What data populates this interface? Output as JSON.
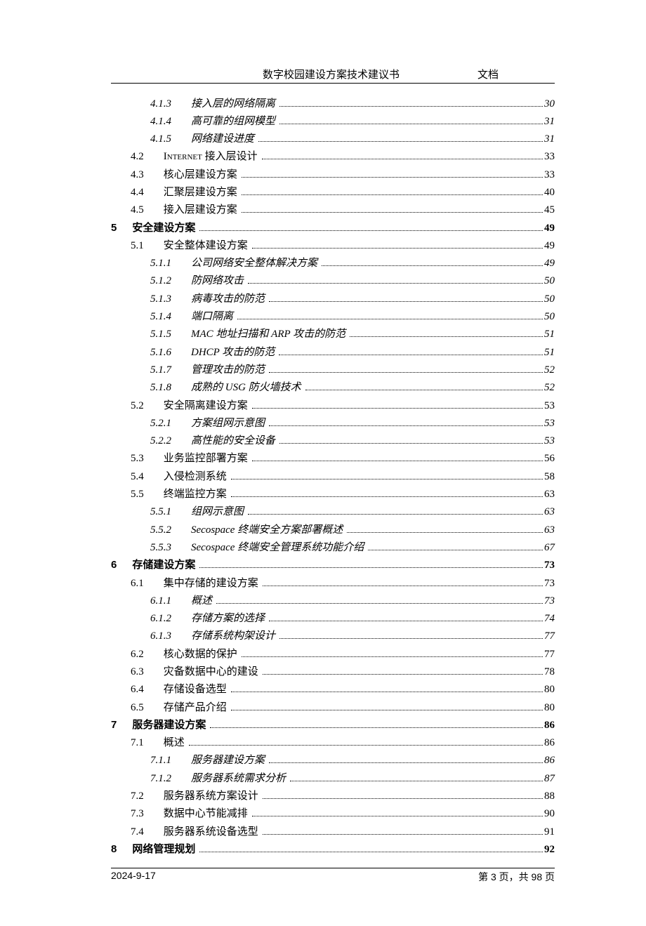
{
  "header": {
    "title": "数字校园建设方案技术建议书",
    "right": "文档"
  },
  "toc": [
    {
      "level": 3,
      "num": "4.1.3",
      "title": "接入层的网络隔离",
      "page": "30"
    },
    {
      "level": 3,
      "num": "4.1.4",
      "title": "高可靠的组网模型",
      "page": "31"
    },
    {
      "level": 3,
      "num": "4.1.5",
      "title": "网络建设进度",
      "page": "31"
    },
    {
      "level": 2,
      "num": "4.2",
      "title": "Internet 接入层设计",
      "smallcaps": true,
      "page": "33"
    },
    {
      "level": 2,
      "num": "4.3",
      "title": "核心层建设方案",
      "page": "33"
    },
    {
      "level": 2,
      "num": "4.4",
      "title": "汇聚层建设方案",
      "page": "40"
    },
    {
      "level": 2,
      "num": "4.5",
      "title": "接入层建设方案",
      "page": "45"
    },
    {
      "level": 1,
      "num": "5",
      "title": "安全建设方案",
      "page": "49"
    },
    {
      "level": 2,
      "num": "5.1",
      "title": "安全整体建设方案",
      "page": "49"
    },
    {
      "level": 3,
      "num": "5.1.1",
      "title": "公司网络安全整体解决方案",
      "page": "49"
    },
    {
      "level": 3,
      "num": "5.1.2",
      "title": "防网络攻击",
      "page": "50"
    },
    {
      "level": 3,
      "num": "5.1.3",
      "title": "病毒攻击的防范",
      "page": "50"
    },
    {
      "level": 3,
      "num": "5.1.4",
      "title": "端口隔离",
      "page": "50"
    },
    {
      "level": 3,
      "num": "5.1.5",
      "title": "MAC 地址扫描和 ARP 攻击的防范",
      "eng": true,
      "page": "51"
    },
    {
      "level": 3,
      "num": "5.1.6",
      "title": "DHCP 攻击的防范",
      "eng": true,
      "page": "51"
    },
    {
      "level": 3,
      "num": "5.1.7",
      "title": "管理攻击的防范",
      "page": "52"
    },
    {
      "level": 3,
      "num": "5.1.8",
      "title": "成熟的 USG 防火墙技术",
      "eng": true,
      "page": "52"
    },
    {
      "level": 2,
      "num": "5.2",
      "title": "安全隔离建设方案",
      "page": "53"
    },
    {
      "level": 3,
      "num": "5.2.1",
      "title": "方案组网示意图",
      "page": "53"
    },
    {
      "level": 3,
      "num": "5.2.2",
      "title": "高性能的安全设备",
      "page": "53"
    },
    {
      "level": 2,
      "num": "5.3",
      "title": "业务监控部署方案",
      "page": "56"
    },
    {
      "level": 2,
      "num": "5.4",
      "title": "入侵检测系统",
      "page": "58"
    },
    {
      "level": 2,
      "num": "5.5",
      "title": "终端监控方案",
      "page": "63"
    },
    {
      "level": 3,
      "num": "5.5.1",
      "title": "组网示意图",
      "page": "63"
    },
    {
      "level": 3,
      "num": "5.5.2",
      "title": "Secospace 终端安全方案部署概述",
      "eng": true,
      "page": "63"
    },
    {
      "level": 3,
      "num": "5.5.3",
      "title": "Secospace 终端安全管理系统功能介绍",
      "eng": true,
      "page": "67"
    },
    {
      "level": 1,
      "num": "6",
      "title": "存储建设方案",
      "page": "73"
    },
    {
      "level": 2,
      "num": "6.1",
      "title": "集中存储的建设方案",
      "page": "73"
    },
    {
      "level": 3,
      "num": "6.1.1",
      "title": "概述",
      "page": "73"
    },
    {
      "level": 3,
      "num": "6.1.2",
      "title": "存储方案的选择",
      "page": "74"
    },
    {
      "level": 3,
      "num": "6.1.3",
      "title": "存储系统构架设计",
      "page": "77"
    },
    {
      "level": 2,
      "num": "6.2",
      "title": "核心数据的保护",
      "page": "77"
    },
    {
      "level": 2,
      "num": "6.3",
      "title": "灾备数据中心的建设",
      "page": "78"
    },
    {
      "level": 2,
      "num": "6.4",
      "title": "存储设备选型",
      "page": "80"
    },
    {
      "level": 2,
      "num": "6.5",
      "title": "存储产品介绍",
      "page": "80"
    },
    {
      "level": 1,
      "num": "7",
      "title": "服务器建设方案",
      "page": "86"
    },
    {
      "level": 2,
      "num": "7.1",
      "title": "概述",
      "page": "86"
    },
    {
      "level": 3,
      "num": "7.1.1",
      "title": "服务器建设方案",
      "page": "86"
    },
    {
      "level": 3,
      "num": "7.1.2",
      "title": "服务器系统需求分析",
      "page": "87"
    },
    {
      "level": 2,
      "num": "7.2",
      "title": "服务器系统方案设计",
      "page": "88"
    },
    {
      "level": 2,
      "num": "7.3",
      "title": "数据中心节能减排",
      "page": "90"
    },
    {
      "level": 2,
      "num": "7.4",
      "title": "服务器系统设备选型",
      "page": "91"
    },
    {
      "level": 1,
      "num": "8",
      "title": "网络管理规划",
      "page": "92"
    }
  ],
  "footer": {
    "date": "2024-9-17",
    "left": "第 3 页，",
    "right": "共 98 页"
  }
}
